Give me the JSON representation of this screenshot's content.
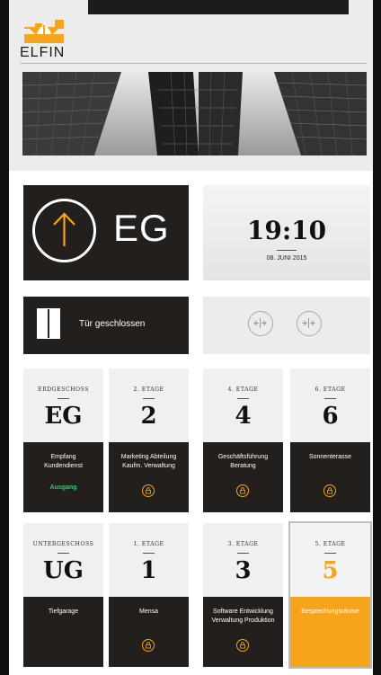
{
  "brand": {
    "name": "ELFIN",
    "colors": {
      "accent": "#f7a41d",
      "dark": "#231f1c",
      "status_green": "#2ecc71"
    }
  },
  "direction": {
    "icon": "arrow-up-icon",
    "floor": "EG"
  },
  "clock": {
    "time": "19:10",
    "date": "08. JUNI 2015"
  },
  "door": {
    "icon": "door-icon",
    "status": "Tür geschlossen"
  },
  "door_controls": [
    {
      "icon": "door-open-icon"
    },
    {
      "icon": "door-close-icon"
    }
  ],
  "floors_row1": [
    {
      "sub": "ERDGESCHOSS",
      "code": "EG",
      "desc": [
        "Empfang",
        "Kundendienst"
      ],
      "status": "Ausgang",
      "locked": false
    },
    {
      "sub": "2. ETAGE",
      "code": "2",
      "desc": [
        "Marketing Abteilung",
        "Kaufm. Verwaltung"
      ],
      "status": "",
      "locked": true
    },
    {
      "sub": "4. ETAGE",
      "code": "4",
      "desc": [
        "Geschäftsführung",
        "Beratung"
      ],
      "status": "",
      "locked": true
    },
    {
      "sub": "6. ETAGE",
      "code": "6",
      "desc": [
        "Sonnenterasse"
      ],
      "status": "",
      "locked": true
    }
  ],
  "floors_row2": [
    {
      "sub": "UNTERGESCHOSS",
      "code": "UG",
      "desc": [
        "Tiefgarage"
      ],
      "status": "",
      "locked": false
    },
    {
      "sub": "1. ETAGE",
      "code": "1",
      "desc": [
        "Mensa"
      ],
      "status": "",
      "locked": true
    },
    {
      "sub": "3. ETAGE",
      "code": "3",
      "desc": [
        "Software Entwicklung",
        "Verwaltung Produktion"
      ],
      "status": "",
      "locked": true
    },
    {
      "sub": "5. ETAGE",
      "code": "5",
      "desc": [
        "Besprechungsräume"
      ],
      "status": "",
      "locked": false,
      "active": true
    }
  ]
}
